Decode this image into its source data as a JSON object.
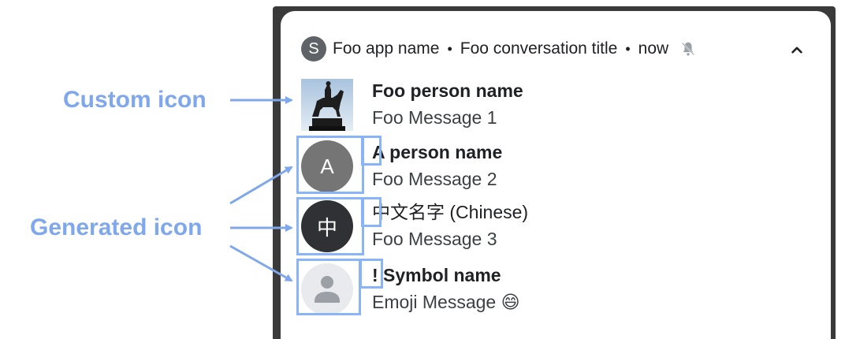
{
  "annotations": {
    "custom_icon": "Custom icon",
    "generated_icon": "Generated icon"
  },
  "notification": {
    "app_badge_letter": "S",
    "app_name": "Foo app name",
    "separator": "•",
    "conversation_title": "Foo conversation title",
    "time": "now",
    "icons": {
      "bell": "bell-off-icon",
      "expand": "chevron-up-icon"
    }
  },
  "messages": [
    {
      "sender": "Foo person name",
      "text": "Foo Message 1",
      "avatar_type": "custom-photo"
    },
    {
      "sender": "A person name",
      "text": "Foo Message 2",
      "avatar_letter": "A",
      "avatar_color": "#757575"
    },
    {
      "sender": "中文名字 (Chinese)",
      "text": "Foo Message 3",
      "avatar_letter": "中",
      "avatar_color": "#303134"
    },
    {
      "sender": "! Symbol name",
      "text": "Emoji Message 😄",
      "avatar_type": "default-person"
    }
  ],
  "colors": {
    "annotation_blue": "#7fa7ec",
    "highlight_blue": "#8ab4f8"
  }
}
